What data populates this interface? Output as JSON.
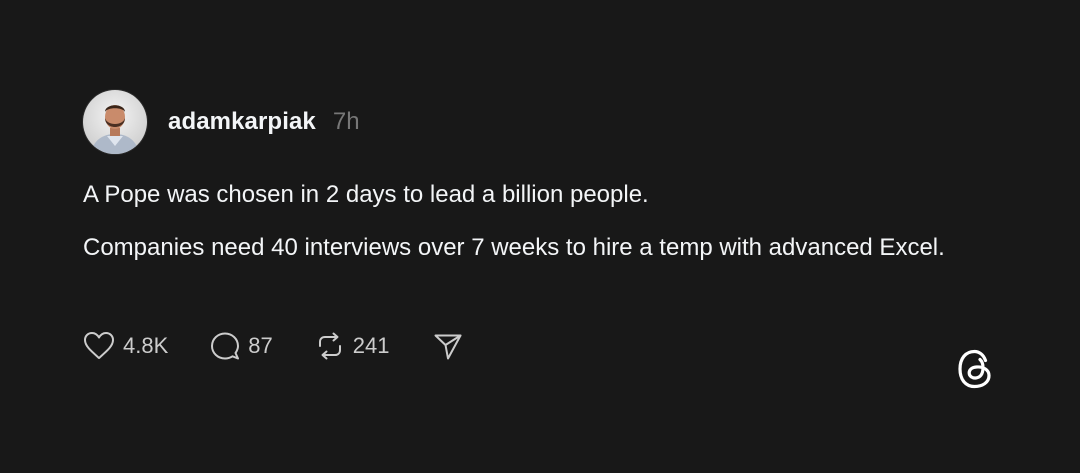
{
  "post": {
    "username": "adamkarpiak",
    "time": "7h",
    "paragraphs": [
      "A Pope was chosen in 2 days to lead a billion people.",
      "Companies need 40 interviews over 7 weeks to hire a temp with advanced Excel."
    ]
  },
  "actions": {
    "likes": "4.8K",
    "replies": "87",
    "reposts": "241"
  },
  "icons": {
    "like": "heart-icon",
    "reply": "speech-bubble-icon",
    "repost": "repost-arrows-icon",
    "share": "paper-plane-icon",
    "brand": "threads-logo-icon"
  },
  "colors": {
    "background": "#181818",
    "text": "#f3f5f7",
    "muted": "#777777",
    "icon": "#cccccc"
  }
}
